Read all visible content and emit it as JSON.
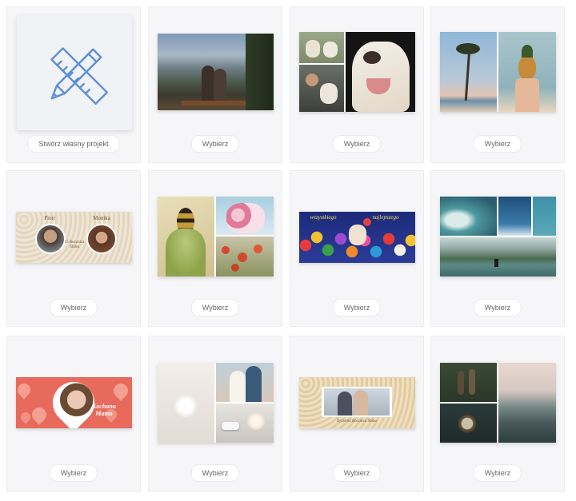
{
  "cards": [
    {
      "button": "Stwórz własny projekt",
      "icon": "pencil-ruler-icon"
    },
    {
      "button": "Wybierz",
      "label": "mountain-couple-photo"
    },
    {
      "button": "Wybierz",
      "label": "dog-collage"
    },
    {
      "button": "Wybierz",
      "label": "palm-pineapple-collage"
    },
    {
      "button": "Wybierz",
      "label": "anniversary-lace-banner",
      "names": [
        "Piotr",
        "Monika"
      ],
      "caption": "15 Rocznica Ślubu"
    },
    {
      "button": "Wybierz",
      "label": "bee-flowers-collage"
    },
    {
      "button": "Wybierz",
      "label": "birthday-balloons-banner",
      "texts": [
        "wszystkiego",
        "najlepszego"
      ]
    },
    {
      "button": "Wybierz",
      "label": "sea-mountains-collage"
    },
    {
      "button": "Wybierz",
      "label": "hearts-mother-banner",
      "caption": "Kochana Mamo"
    },
    {
      "button": "Wybierz",
      "label": "wedding-collage"
    },
    {
      "button": "Wybierz",
      "label": "lace-photo-banner",
      "caption": "Życzenia Rocznica Ślubu"
    },
    {
      "button": "Wybierz",
      "label": "forest-mountains-collage"
    }
  ],
  "colors": {
    "card_bg": "#f6f6f8",
    "icon_blue": "#5b8fd6",
    "heart_red": "#e86a5c"
  }
}
